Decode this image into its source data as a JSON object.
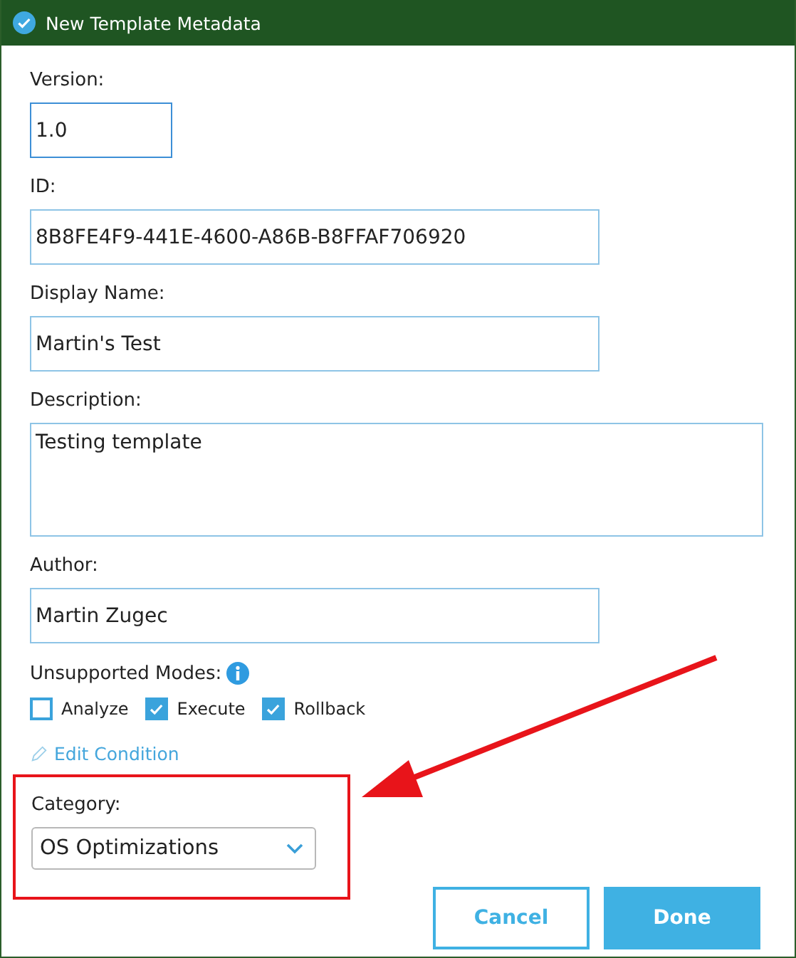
{
  "window": {
    "title": "New Template Metadata"
  },
  "fields": [
    {
      "label": "Version:",
      "value": "1.0",
      "kind": "short",
      "focused": true
    },
    {
      "label": "ID:",
      "value": "8B8FE4F9-441E-4600-A86B-B8FFAF706920",
      "kind": "medium",
      "focused": false
    },
    {
      "label": "Display Name:",
      "value": "Martin's Test",
      "kind": "medium",
      "focused": false
    },
    {
      "label": "Description:",
      "value": "Testing template",
      "kind": "multiline",
      "focused": false
    },
    {
      "label": "Author:",
      "value": "Martin Zugec",
      "kind": "medium",
      "focused": false
    }
  ],
  "unsupported_modes": {
    "label": "Unsupported Modes:",
    "options": [
      {
        "label": "Analyze",
        "checked": false
      },
      {
        "label": "Execute",
        "checked": true
      },
      {
        "label": "Rollback",
        "checked": true
      }
    ]
  },
  "edit_condition": {
    "label": "Edit Condition"
  },
  "category": {
    "label": "Category:",
    "value": "OS Optimizations",
    "highlighted": true
  },
  "annotation_arrow": true,
  "buttons": [
    {
      "label": "Cancel",
      "kind": "secondary"
    },
    {
      "label": "Done",
      "kind": "primary"
    }
  ]
}
